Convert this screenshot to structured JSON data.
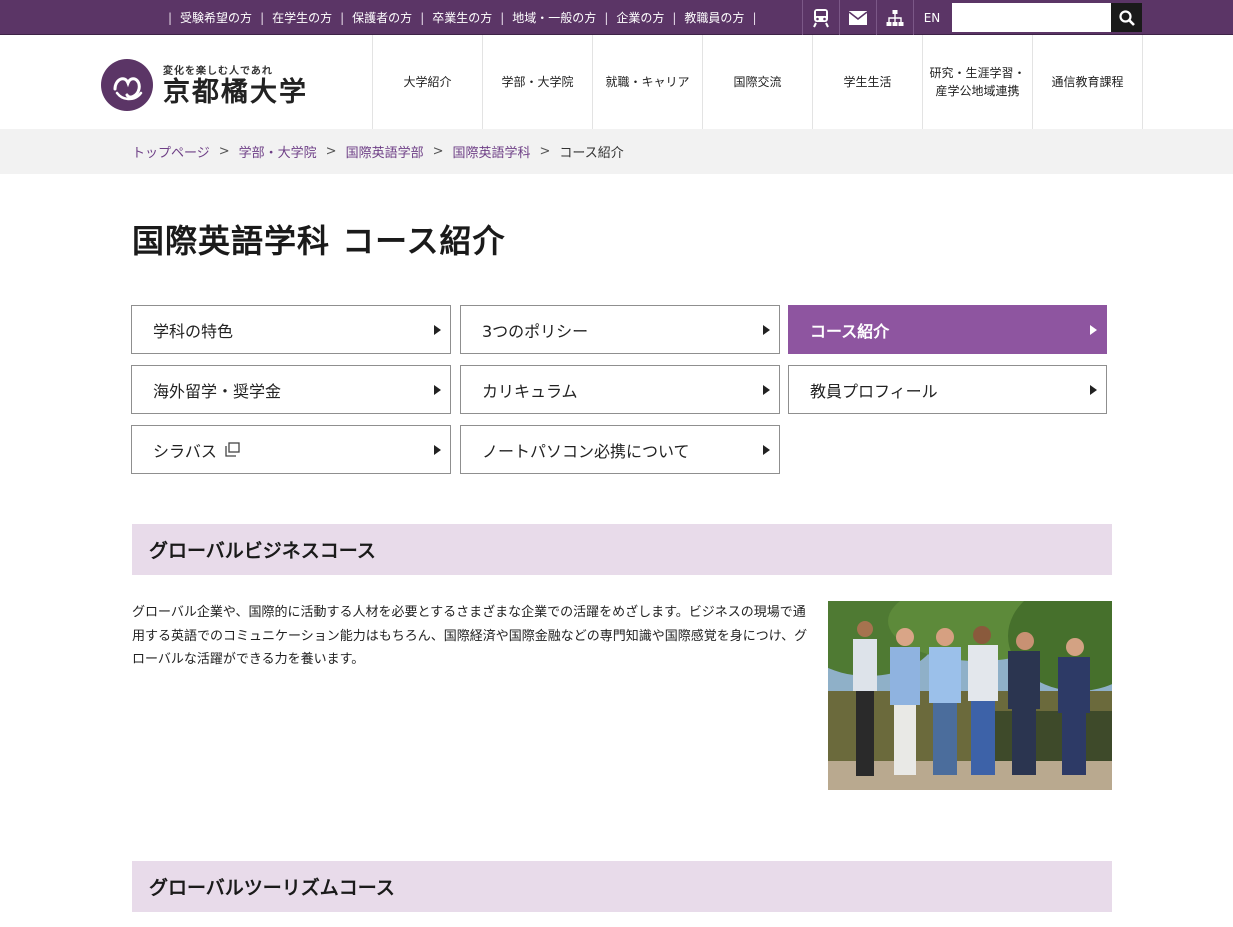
{
  "topbar": {
    "links": [
      "受験希望の方",
      "在学生の方",
      "保護者の方",
      "卒業生の方",
      "地域・一般の方",
      "企業の方",
      "教職員の方"
    ],
    "icons": [
      "train-icon",
      "mail-icon",
      "sitemap-icon"
    ],
    "lang": "EN",
    "search_placeholder": ""
  },
  "header": {
    "tagline": "変化を楽しむ人であれ",
    "university_name": "京都橘大学",
    "nav": [
      "大学紹介",
      "学部・大学院",
      "就職・キャリア",
      "国際交流",
      "学生生活",
      "研究・生涯学習・\n産学公地域連携",
      "通信教育課程"
    ]
  },
  "breadcrumb": {
    "links": [
      "トップページ",
      "学部・大学院",
      "国際英語学部",
      "国際英語学科"
    ],
    "current": "コース紹介"
  },
  "page_title": "国際英語学科 コース紹介",
  "subnav": {
    "items": [
      "学科の特色",
      "3つのポリシー",
      "コース紹介",
      "海外留学・奨学金",
      "カリキュラム",
      "教員プロフィール",
      "シラバス",
      "ノートパソコン必携について"
    ],
    "active": "コース紹介"
  },
  "sections": [
    {
      "title": "グローバルビジネスコース",
      "text": "グローバル企業や、国際的に活動する人材を必要とするさまざまな企業での活躍をめざします。ビジネスの現場で通用する英語でのコミュニケーション能力はもちろん、国際経済や国際金融などの専門知識や国際感覚を身につけ、グローバルな活躍ができる力を養います。"
    },
    {
      "title": "グローバルツーリズムコース"
    }
  ],
  "colors": {
    "brand_purple": "#5b3566",
    "active_button": "#8e55a0",
    "section_header_bg": "#e8dbea",
    "breadcrumb_link": "#6e3f86"
  }
}
